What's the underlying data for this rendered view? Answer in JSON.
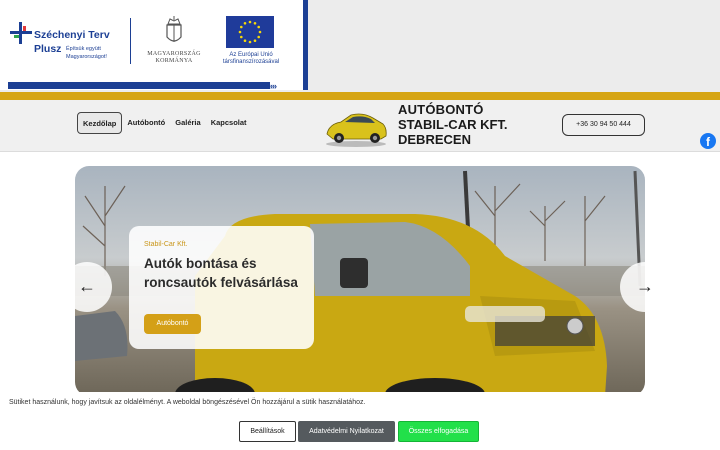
{
  "grant": {
    "title_line1": "Széchenyi Terv",
    "title_line2": "Plusz",
    "tagline_line1": "Építsük együtt",
    "tagline_line2": "Magyarországot!",
    "gov_line1": "MAGYARORSZÁG",
    "gov_line2": "KORMÁNYA",
    "eu_line1": "Az Európai Unió",
    "eu_line2": "társfinanszírozásával",
    "chevrons": "»»"
  },
  "header": {
    "nav": [
      "Kezdőlap",
      "Autóbontó",
      "Galéria",
      "Kapcsolat"
    ],
    "brand_line1": "AUTÓBONTÓ",
    "brand_line2": "STABIL-CAR KFT.",
    "brand_line3": "DEBRECEN",
    "phone": "+36 30 94 50 444",
    "facebook_glyph": "f"
  },
  "hero": {
    "tag": "Stabil-Car Kft.",
    "title_line1": "Autók bontása és",
    "title_line2": "roncsautók felvásárlása",
    "button": "Autóbontó",
    "prev": "←",
    "next": "→"
  },
  "cookie": {
    "text": "Sütiket használunk, hogy javítsuk az oldalélményt. A weboldal böngészésével Ön hozzájárul a sütik használatához.",
    "settings": "Beállítások",
    "privacy": "Adatvédelmi Nyilatkozat",
    "accept": "Összes elfogadása"
  },
  "colors": {
    "brand_blue": "#1c3f94",
    "accent_yellow": "#d4a017",
    "accept_green": "#22e04a"
  }
}
